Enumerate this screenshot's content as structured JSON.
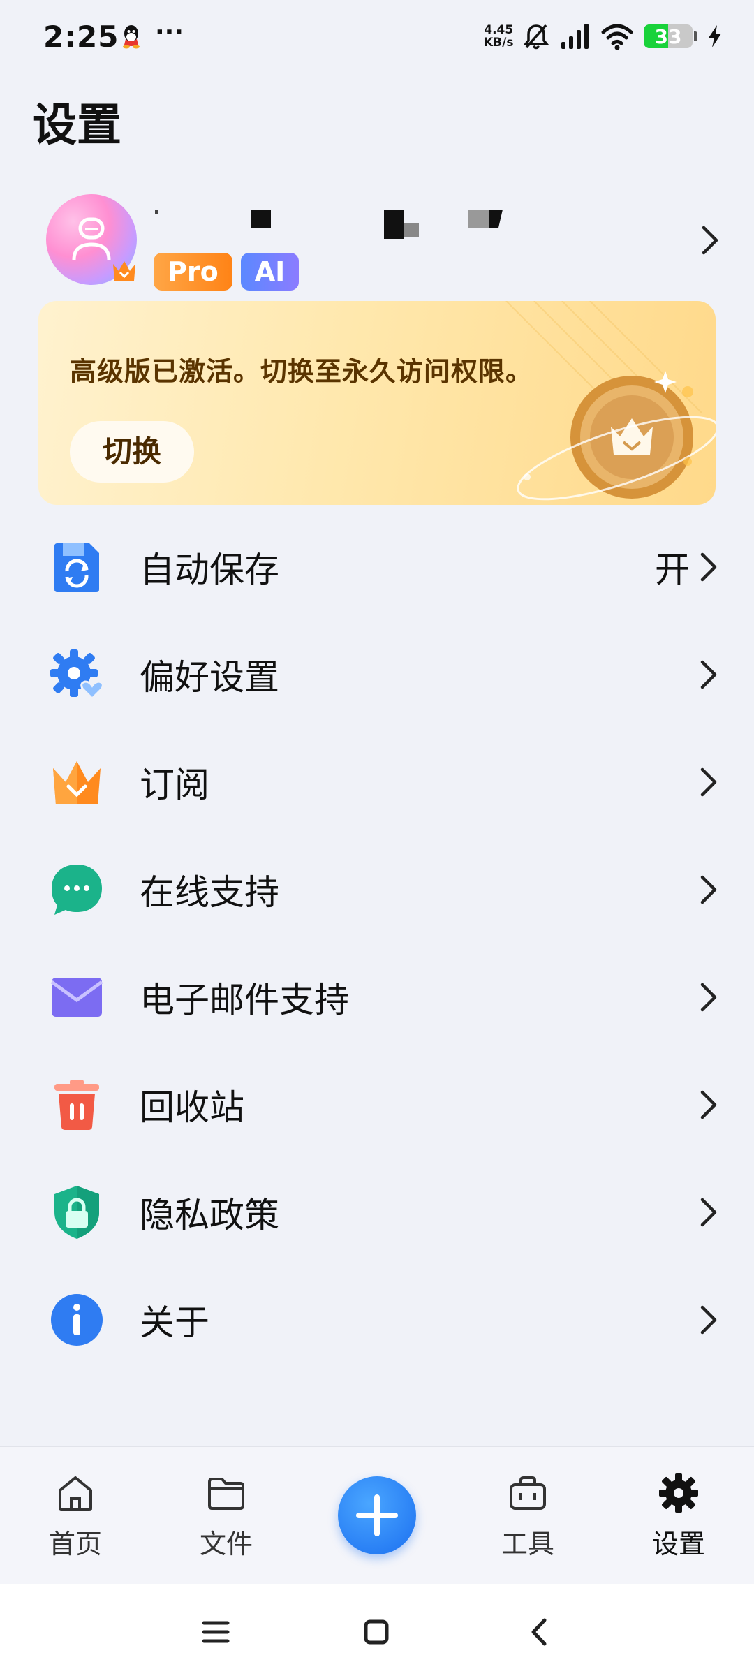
{
  "status_bar": {
    "time": "2:25",
    "more": "···",
    "net_speed_value": "4.45",
    "net_speed_unit": "KB/s",
    "battery_level": "33",
    "battery_color": "#19d23a"
  },
  "page": {
    "title": "设置"
  },
  "profile": {
    "badges": {
      "pro": "Pro",
      "ai": "AI"
    }
  },
  "banner": {
    "text": "高级版已激活。切换至永久访问权限。",
    "button": "切换"
  },
  "settings": {
    "auto_save": {
      "label": "自动保存",
      "value": "开",
      "icon": "floppy-sync-icon"
    },
    "preferences": {
      "label": "偏好设置",
      "icon": "gear-heart-icon"
    },
    "subscription": {
      "label": "订阅",
      "icon": "crown-icon"
    },
    "online_support": {
      "label": "在线支持",
      "icon": "chat-bubble-icon"
    },
    "email_support": {
      "label": "电子邮件支持",
      "icon": "envelope-icon"
    },
    "recycle_bin": {
      "label": "回收站",
      "icon": "trash-icon"
    },
    "privacy": {
      "label": "隐私政策",
      "icon": "shield-lock-icon"
    },
    "about": {
      "label": "关于",
      "icon": "info-icon"
    }
  },
  "bottom_nav": {
    "home": "首页",
    "files": "文件",
    "tools": "工具",
    "settings": "设置",
    "accent": "#1b6ff0"
  }
}
